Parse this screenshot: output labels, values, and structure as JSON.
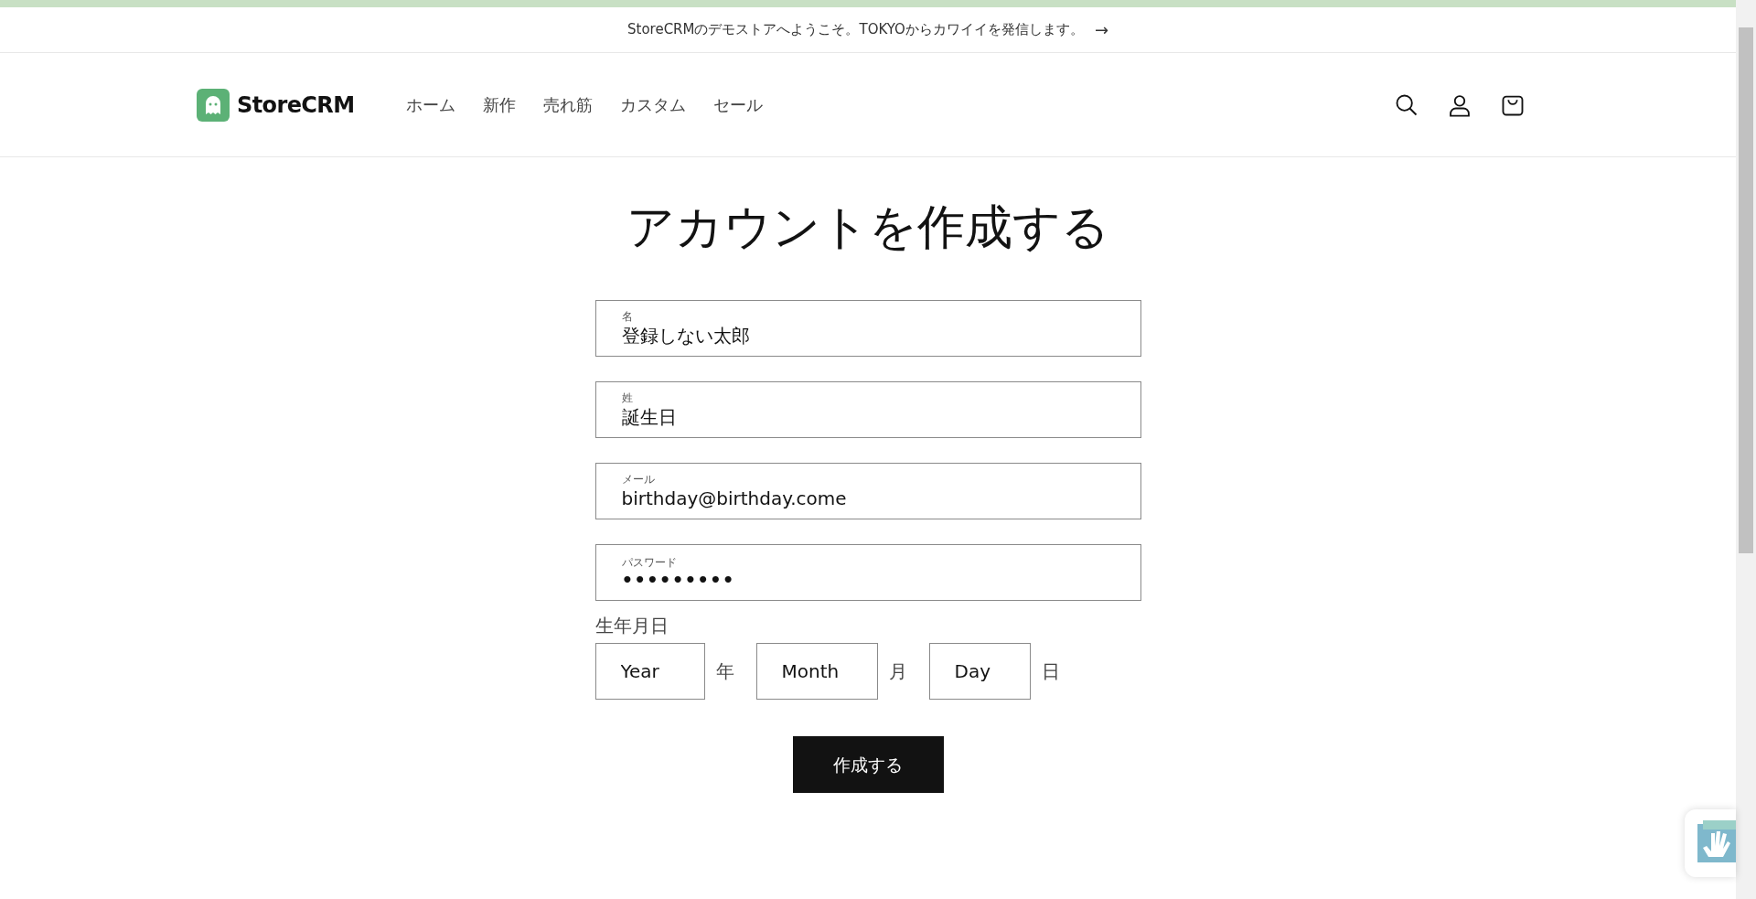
{
  "announcement": {
    "text": "StoreCRMのデモストアへようこそ。TOKYOからカワイイを発信します。",
    "arrow": "→"
  },
  "header": {
    "logo": "StoreCRM",
    "nav": [
      {
        "label": "ホーム"
      },
      {
        "label": "新作"
      },
      {
        "label": "売れ筋"
      },
      {
        "label": "カスタム"
      },
      {
        "label": "セール"
      }
    ]
  },
  "page": {
    "title": "アカウントを作成する",
    "fields": [
      {
        "label": "名",
        "value": "登録しない太郎",
        "kind": "text"
      },
      {
        "label": "姓",
        "value": "誕生日",
        "kind": "text"
      },
      {
        "label": "メール",
        "value": "birthday@birthday.come",
        "kind": "text"
      },
      {
        "label": "パスワード",
        "value": "•••••••••",
        "kind": "password"
      }
    ],
    "birthday": {
      "label": "生年月日",
      "parts": [
        {
          "placeholder": "Year",
          "unit": "年"
        },
        {
          "placeholder": "Month",
          "unit": "月"
        },
        {
          "placeholder": "Day",
          "unit": "日"
        }
      ]
    },
    "submit": "作成する"
  }
}
